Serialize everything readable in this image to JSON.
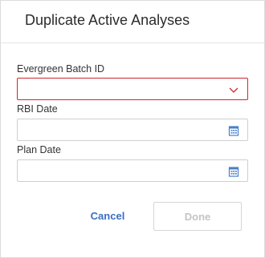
{
  "dialog": {
    "title": "Duplicate Active Analyses"
  },
  "fields": {
    "batch": {
      "label": "Evergreen Batch ID",
      "value": "",
      "icon": "chevron-down-icon",
      "error": true
    },
    "rbi_date": {
      "label": "RBI Date",
      "value": "",
      "icon": "calendar-icon"
    },
    "plan_date": {
      "label": "Plan Date",
      "value": "",
      "icon": "calendar-icon"
    }
  },
  "buttons": {
    "cancel": "Cancel",
    "done": "Done"
  },
  "colors": {
    "error_border": "#d0262d",
    "link_blue": "#3a6fc4",
    "disabled_text": "#c4c4c4",
    "icon_blue": "#4a7fc7"
  }
}
